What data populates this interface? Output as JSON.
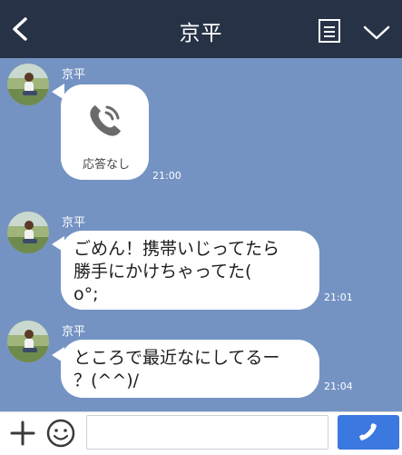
{
  "header": {
    "title": "京平"
  },
  "messages": [
    {
      "sender": "京平",
      "type": "call",
      "call_label": "応答なし",
      "time": "21:00"
    },
    {
      "sender": "京平",
      "type": "text",
      "lines": [
        "ごめん！携帯いじってたら",
        "勝手にかけちゃってた(",
        "o°;"
      ],
      "time": "21:01"
    },
    {
      "sender": "京平",
      "type": "text",
      "lines": [
        "ところで最近なにしてるー",
        "？(^^)/"
      ],
      "time": "21:04"
    }
  ],
  "input": {
    "value": "",
    "placeholder": ""
  },
  "colors": {
    "header_bg": "#273246",
    "chat_bg": "#7493c3",
    "call_button": "#3b78e0"
  },
  "icons": [
    "back-icon",
    "menu-icon",
    "chevron-down-icon",
    "phone-icon",
    "plus-icon",
    "emoji-icon",
    "phone-icon"
  ]
}
